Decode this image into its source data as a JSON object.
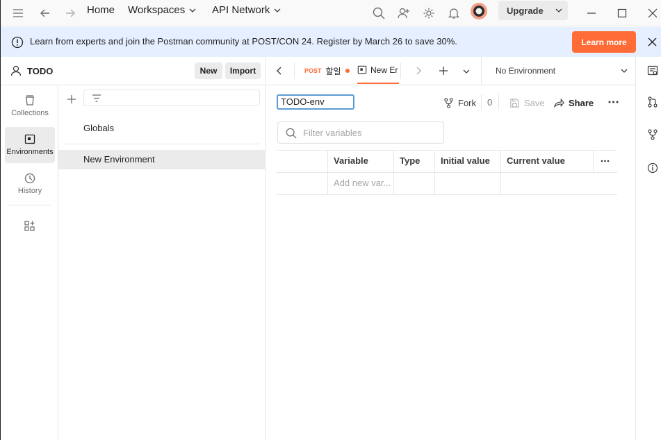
{
  "header": {
    "home_label": "Home",
    "workspaces_label": "Workspaces",
    "api_network_label": "API Network",
    "upgrade_label": "Upgrade"
  },
  "banner": {
    "text": "Learn from experts and join the Postman community at POST/CON 24. Register by March 26 to save 30%.",
    "cta_label": "Learn more"
  },
  "workspace": {
    "name": "TODO",
    "new_label": "New",
    "import_label": "Import"
  },
  "rail": {
    "items": [
      {
        "label": "Collections",
        "icon": "collections-icon"
      },
      {
        "label": "Environments",
        "icon": "environments-icon"
      },
      {
        "label": "History",
        "icon": "history-icon"
      }
    ]
  },
  "environments": {
    "items": [
      {
        "label": "Globals"
      },
      {
        "label": "New Environment"
      }
    ]
  },
  "tabs": [
    {
      "method": "POST",
      "title": "할일",
      "unsaved": true
    },
    {
      "title": "New Er",
      "active": true
    }
  ],
  "environment_selector": {
    "selected": "No Environment"
  },
  "editor": {
    "env_name": "TODO-env",
    "fork_label": "Fork",
    "fork_count": "0",
    "save_label": "Save",
    "share_label": "Share",
    "filter_placeholder": "Filter variables",
    "columns": [
      "Variable",
      "Type",
      "Initial value",
      "Current value"
    ],
    "new_row_placeholder": "Add new var..."
  },
  "colors": {
    "accent": "#ff6c37",
    "banner_bg": "#e6efff",
    "focus_border": "#5b9bd5"
  }
}
